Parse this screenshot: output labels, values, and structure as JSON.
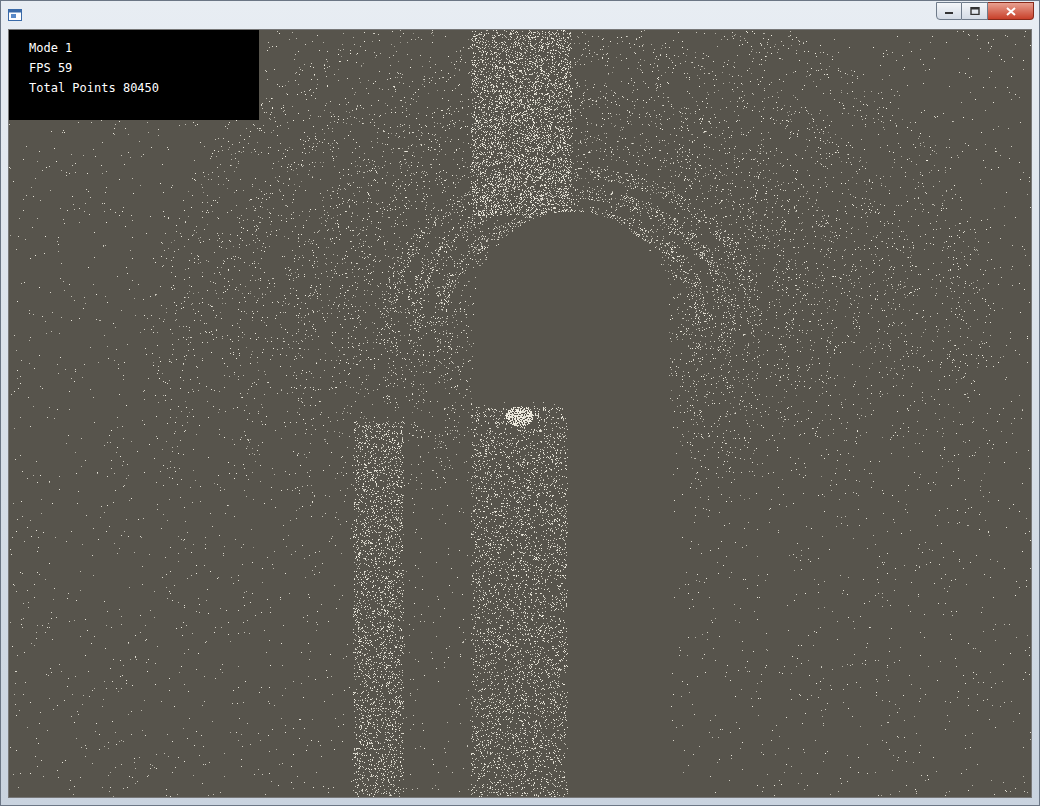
{
  "window": {
    "controls": [
      {
        "name": "minimize"
      },
      {
        "name": "maximize"
      },
      {
        "name": "close"
      }
    ]
  },
  "overlay": {
    "lines": [
      "Mode 1",
      "FPS 59",
      "Total Points 80450"
    ]
  }
}
